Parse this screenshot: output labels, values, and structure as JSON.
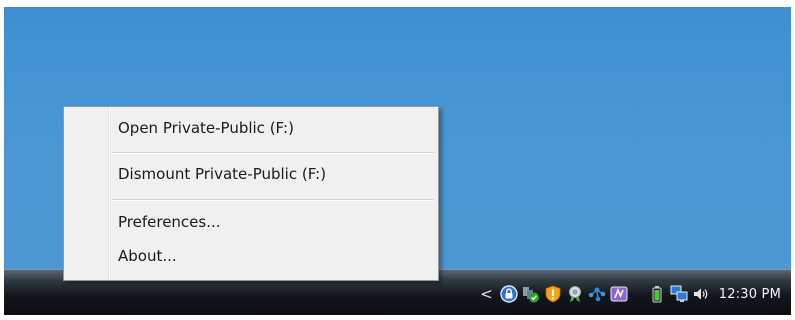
{
  "context_menu": {
    "items": [
      {
        "label": "Open Private-Public (F:)"
      },
      {
        "label": "Dismount Private-Public (F:)"
      },
      {
        "label": "Preferences..."
      },
      {
        "label": "About..."
      }
    ]
  },
  "taskbar": {
    "show_hidden_icons": "<",
    "tray_icons": [
      "encryption-lock-icon",
      "network-check-icon",
      "security-shield-icon",
      "award-icon",
      "share-network-icon",
      "app-icon",
      "battery-icon",
      "network-monitors-icon",
      "volume-icon"
    ],
    "clock": "12:30 PM"
  },
  "colors": {
    "desktop": "#4a94d0",
    "taskbar": "#13171c",
    "menu_background": "#f0f0f0"
  }
}
